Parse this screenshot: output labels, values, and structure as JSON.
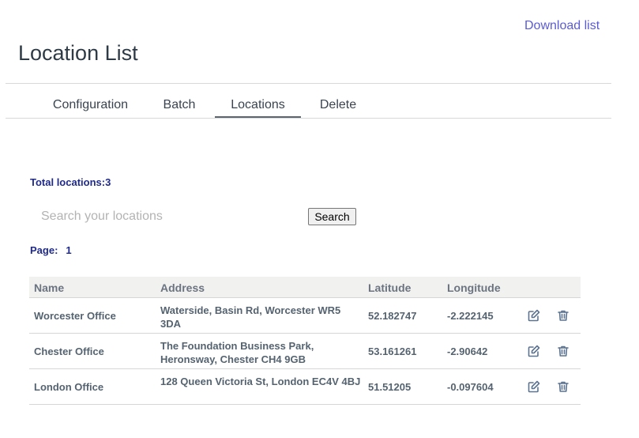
{
  "header": {
    "download_label": "Download list",
    "title": "Location List"
  },
  "tabs": [
    {
      "label": "Configuration",
      "active": false
    },
    {
      "label": "Batch",
      "active": false
    },
    {
      "label": "Locations",
      "active": true
    },
    {
      "label": "Delete",
      "active": false
    }
  ],
  "summary": {
    "total_label": "Total locations:3"
  },
  "search": {
    "placeholder": "Search your locations",
    "value": "",
    "button_label": "Search"
  },
  "pagination": {
    "label": "Page:",
    "current": "1"
  },
  "table": {
    "columns": [
      "Name",
      "Address",
      "Latitude",
      "Longitude"
    ],
    "rows": [
      {
        "name": "Worcester Office",
        "address": "Waterside, Basin Rd, Worcester WR5 3DA",
        "latitude": "52.182747",
        "longitude": "-2.222145"
      },
      {
        "name": "Chester Office",
        "address": "The Foundation Business Park, Heronsway, Chester CH4 9GB",
        "latitude": "53.161261",
        "longitude": "-2.90642"
      },
      {
        "name": "London Office",
        "address": "128 Queen Victoria St, London EC4V 4BJ",
        "latitude": "51.51205",
        "longitude": "-0.097604"
      }
    ],
    "row_actions": [
      "edit-icon",
      "trash-icon"
    ]
  },
  "colors": {
    "link": "#5b5bd6",
    "accent_text": "#1f2a8a",
    "cell_text": "#556370",
    "header_bg": "#f1f1ef",
    "icon": "#5d7490"
  }
}
